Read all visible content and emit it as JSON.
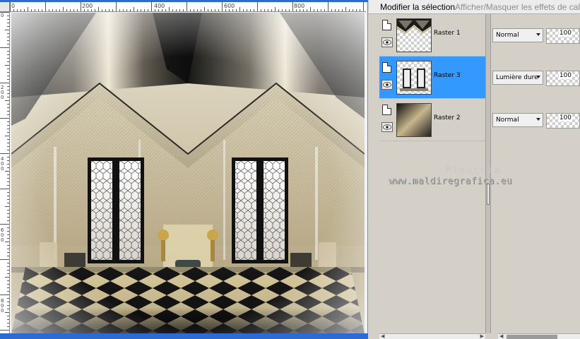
{
  "layers_panel": {
    "tabs": [
      "Modifier la sélection",
      "Afficher/Masquer les effets de calque"
    ],
    "layers": [
      {
        "name": "Raster 1",
        "blend_mode": "Normal",
        "opacity": "100",
        "selected": false
      },
      {
        "name": "Raster 3",
        "blend_mode": "Lumière dure",
        "opacity": "100",
        "selected": true
      },
      {
        "name": "Raster 2",
        "blend_mode": "Normal",
        "opacity": "100",
        "selected": false
      }
    ]
  },
  "canvas": {
    "ruler_h_labels": [
      "0",
      "200",
      "400",
      "600",
      "800"
    ],
    "ruler_v_labels": [
      "0",
      "200",
      "400",
      "600",
      "800"
    ]
  },
  "watermark": {
    "line1": "Pinuccia",
    "line2": "www.maldiregrafica.eu"
  },
  "colors": {
    "selected_row": "#3399ff",
    "title_bar": "#2d6ad4",
    "panel_bg": "#d4d0c8"
  },
  "icons": [
    "page-icon",
    "eye-icon",
    "chevron-down-icon"
  ]
}
